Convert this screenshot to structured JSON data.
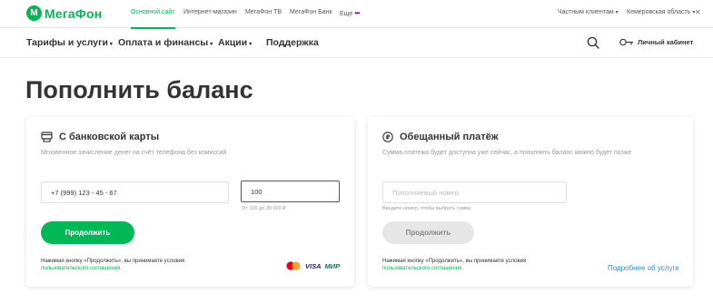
{
  "brand": {
    "name": "МегаФон",
    "color": "#00b956"
  },
  "topbar": {
    "links": [
      "Основной сайт",
      "Интернет-магазин",
      "МегаФон ТВ",
      "МегаФон Банк",
      "Еще"
    ],
    "more_dots": "•••",
    "customers": "Частным клиентам",
    "region": "Кемеровская область",
    "close_glyph": "✕"
  },
  "nav": {
    "items": [
      "Тарифы и услуги",
      "Оплата и финансы",
      "Акции",
      "Поддержка"
    ],
    "account": "Личный кабинет"
  },
  "page_title": "Пополнить баланс",
  "card_card": {
    "title": "С банковской карты",
    "subtitle": "Мгновенное зачисление денег на счёт телефона без комиссий",
    "phone_value": "+7 (999) 123 - 45 - 67",
    "amount_value": "100",
    "amount_hint": "От 100 до 30 000 ₽",
    "button": "Продолжить",
    "legal_line1": "Нажимая кнопку «Продолжить», вы принимаете условия",
    "legal_link": "пользовательского соглашения.",
    "visa": "VISA",
    "mir": "МИР"
  },
  "promise_card": {
    "title": "Обещанный платёж",
    "subtitle": "Сумма платежа будет доступна уже сейчас, а пополнить баланс можно будет позже",
    "input_placeholder": "Пополняемый номер",
    "input_hint": "Введите номер, чтобы выбрать сумму",
    "button": "Продолжить",
    "legal_line1": "Нажимая кнопку «Продолжить», вы принимаете условия",
    "legal_link": "пользовательского соглашения.",
    "more_link": "Подробнее об услуге"
  }
}
